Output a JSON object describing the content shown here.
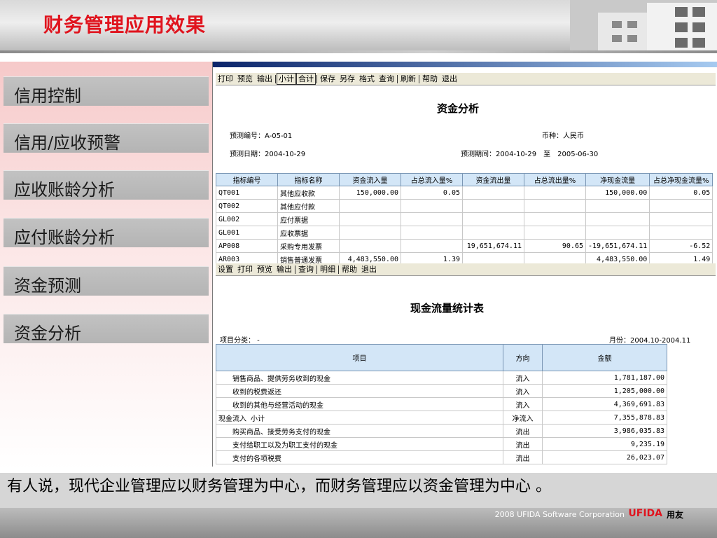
{
  "header": {
    "title": "财务管理应用效果"
  },
  "sidebar": {
    "items": [
      {
        "label": "信用控制"
      },
      {
        "label": "信用/应收预警"
      },
      {
        "label": "应收账龄分析"
      },
      {
        "label": "应付账龄分析"
      },
      {
        "label": "资金预测"
      },
      {
        "label": "资金分析"
      }
    ]
  },
  "window1": {
    "toolbar": [
      "打印",
      "预览",
      "输出",
      "小计",
      "合计",
      "保存",
      "另存",
      "格式",
      "查询",
      "刷新",
      "帮助",
      "退出"
    ],
    "title": "资金分析",
    "forecast_no": "预测编号：A-05-01",
    "currency": "币种：人民币",
    "forecast_date": "预测日期：2004-10-29",
    "forecast_period": "预测期间：2004-10-29　至　2005-06-30",
    "columns": [
      "指标编号",
      "指标名称",
      "资金流入量",
      "占总流入量%",
      "资金流出量",
      "占总流出量%",
      "净现金流量",
      "占总净现金流量%"
    ],
    "rows": [
      [
        "QT001",
        "其他应收款",
        "150,000.00",
        "0.05",
        "",
        "",
        "150,000.00",
        "0.05"
      ],
      [
        "QT002",
        "其他应付款",
        "",
        "",
        "",
        "",
        "",
        ""
      ],
      [
        "GL002",
        "应付票据",
        "",
        "",
        "",
        "",
        "",
        ""
      ],
      [
        "GL001",
        "应收票据",
        "",
        "",
        "",
        "",
        "",
        ""
      ],
      [
        "AP008",
        "采购专用发票",
        "",
        "",
        "19,651,674.11",
        "90.65",
        "-19,651,674.11",
        "-6.52"
      ],
      [
        "AR003",
        "销售普通发票",
        "4,483,550.00",
        "1.39",
        "",
        "",
        "4,483,550.00",
        "1.49"
      ]
    ]
  },
  "window2": {
    "toolbar": [
      "设置",
      "打印",
      "预览",
      "输出",
      "查询",
      "明细",
      "帮助",
      "退出"
    ],
    "title": "现金流量统计表",
    "category": "项目分类：  -",
    "month": "月份：2004.10-2004.11",
    "columns": [
      "项目",
      "方向",
      "金额"
    ],
    "rows": [
      [
        "　　销售商品、提供劳务收到的现金",
        "流入",
        "1,781,187.00"
      ],
      [
        "　　收到的税费返还",
        "流入",
        "1,205,000.00"
      ],
      [
        "　　收到的其他与经营活动的现金",
        "流入",
        "4,369,691.83"
      ],
      [
        "现金流入  小计",
        "净流入",
        "7,355,878.83"
      ],
      [
        "　　购买商品、接受劳务支付的现金",
        "流出",
        "3,986,035.83"
      ],
      [
        "　　支付给职工以及为职工支付的现金",
        "流出",
        "9,235.19"
      ],
      [
        "　　支付的各项税费",
        "流出",
        "26,023.07"
      ]
    ]
  },
  "caption": {
    "text": "有人说，现代企业管理应以财务管理为中心，而财务管理应以资金管理为中心 。"
  },
  "footer": {
    "copyright": "2008 UFIDA Software Corporation",
    "logo": "UFIDA",
    "logo_cn": "用友"
  },
  "colors": {
    "title_red": "#e0141e",
    "grid_header": "#d3e6f7"
  }
}
